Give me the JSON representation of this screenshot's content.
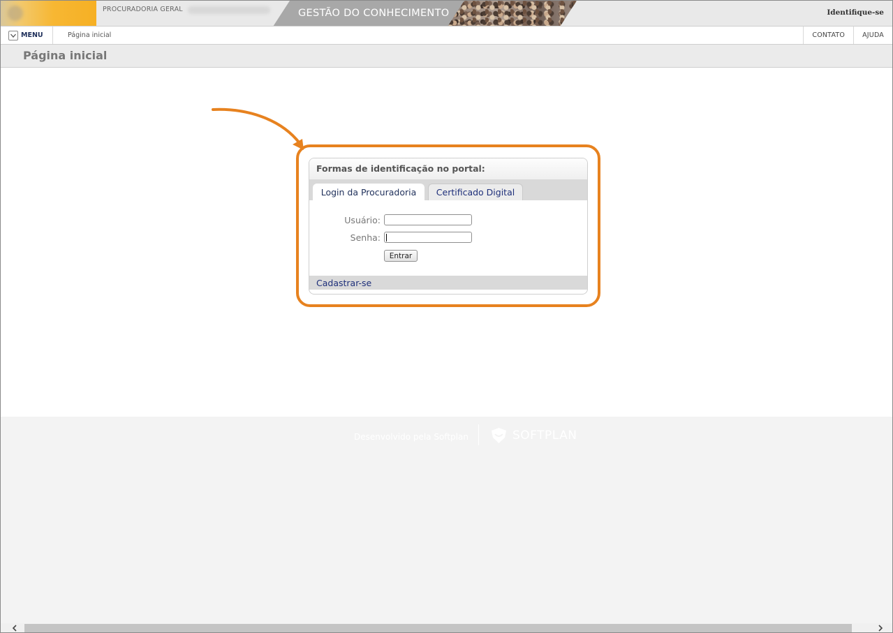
{
  "header": {
    "org_name": "PROCURADORIA GERAL",
    "portal_title": "GESTÃO DO CONHECIMENTO",
    "identify_label": "Identifique-se"
  },
  "nav": {
    "menu_label": "MENU",
    "breadcrumb": "Página inicial",
    "links": [
      "CONTATO",
      "AJUDA"
    ]
  },
  "page": {
    "title": "Página inicial"
  },
  "login_panel": {
    "heading": "Formas de identificação no portal:",
    "tabs": [
      {
        "label": "Login da Procuradoria",
        "active": true
      },
      {
        "label": "Certificado Digital",
        "active": false
      }
    ],
    "user_label": "Usuário:",
    "user_value": "",
    "password_label": "Senha:",
    "password_value": "",
    "submit_label": "Entrar",
    "register_link": "Cadastrar-se"
  },
  "footer": {
    "developed_by": "Desenvolvido pela Softplan",
    "brand": "SOFTPLAN"
  },
  "colors": {
    "highlight": "#e7821f",
    "link": "#1e2f7a"
  },
  "icons": {
    "menu": "chevron-down-icon",
    "brand": "softplan-logo-icon",
    "scroll_left": "chevron-left-icon",
    "scroll_right": "chevron-right-icon"
  }
}
